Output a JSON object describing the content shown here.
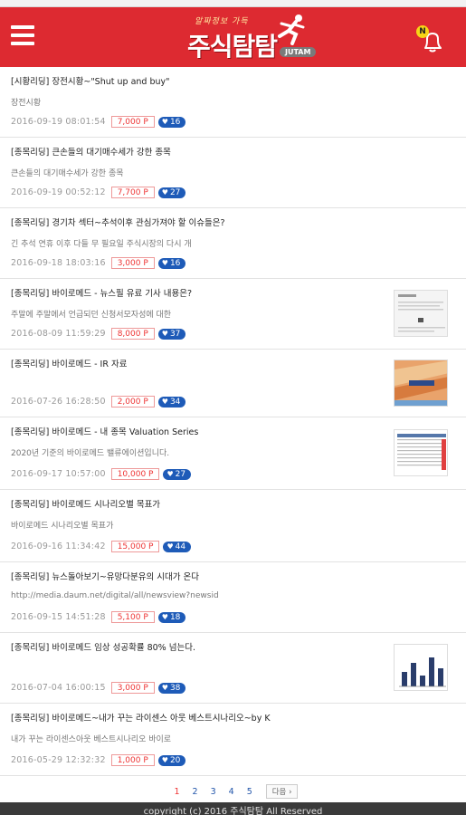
{
  "header": {
    "logo_tagline": "알짜정보 가득",
    "logo_text": "주식탐탐",
    "logo_badge": "JUTAM",
    "bell_badge": "N"
  },
  "items": [
    {
      "title": "[시황리딩] 장전시황~\"Shut up and buy\"",
      "summary": "장전시황",
      "date": "2016-09-19 08:01:54",
      "price": "7,000 P",
      "likes": "16",
      "thumb": null
    },
    {
      "title": "[종목리딩] 큰손들의 대기매수세가 강한 종목",
      "summary": "큰손들의 대기매수세가 강한 종목",
      "date": "2016-09-19 00:52:12",
      "price": "7,700 P",
      "likes": "27",
      "thumb": null
    },
    {
      "title": "[종목리딩] 경기차 섹터~추석이후 관심가져야 할 이슈들은?",
      "summary": "긴 추석 연휴 이후 다들 무 필요일 주식시장의 다시 개",
      "date": "2016-09-18 18:03:16",
      "price": "3,000 P",
      "likes": "16",
      "thumb": null
    },
    {
      "title": "[종목리딩] 바이로메드 - 뉴스필 유료 기사 내용은?",
      "summary": "주말에 주말에서 언급되던 신청서모자성에 대한",
      "date": "2016-08-09 11:59:29",
      "price": "8,000 P",
      "likes": "37",
      "thumb": "doc"
    },
    {
      "title": "[종목리딩] 바이로메드 - IR 자료",
      "summary": "",
      "date": "2016-07-26 16:28:50",
      "price": "2,000 P",
      "likes": "34",
      "thumb": "ir"
    },
    {
      "title": "[종목리딩] 바이로메드 - 내 종목 Valuation Series",
      "summary": "2020년 기준의 바이로메드 밸류에이션입니다.",
      "date": "2016-09-17 10:57:00",
      "price": "10,000 P",
      "likes": "27",
      "thumb": "table"
    },
    {
      "title": "[종목리딩] 바이로메드 시나리오별 목표가",
      "summary": "바이로메드 시나리오별 목표가",
      "date": "2016-09-16 11:34:42",
      "price": "15,000 P",
      "likes": "44",
      "thumb": null
    },
    {
      "title": "[종목리딩] 뉴스돌아보기~유망다분유의 시대가 온다",
      "summary": "http://media.daum.net/digital/all/newsview?newsid",
      "date": "2016-09-15 14:51:28",
      "price": "5,100 P",
      "likes": "18",
      "thumb": null
    },
    {
      "title": "[종목리딩] 바이로메드 임상 성공확률 80% 넘는다.",
      "summary": "",
      "date": "2016-07-04 16:00:15",
      "price": "3,000 P",
      "likes": "38",
      "thumb": "chart"
    },
    {
      "title": "[종목리딩] 바이로메드~내가 꾸는 라이센스 아웃 베스트시나리오~by K",
      "summary": "내가 꾸는 라이센스아웃 베스트시나리오 바이로",
      "date": "2016-05-29 12:32:32",
      "price": "1,000 P",
      "likes": "20",
      "thumb": null
    }
  ],
  "pagination": {
    "pages": [
      "1",
      "2",
      "3",
      "4",
      "5"
    ],
    "current": "1",
    "next_label": "다음 ›"
  },
  "footer": {
    "text": "copyright (c) 2016 주식탐탐 All Reserved"
  },
  "colors": {
    "brand_red": "#dd2a31",
    "like_blue": "#1e5bb8",
    "price_red": "#ee3333"
  }
}
